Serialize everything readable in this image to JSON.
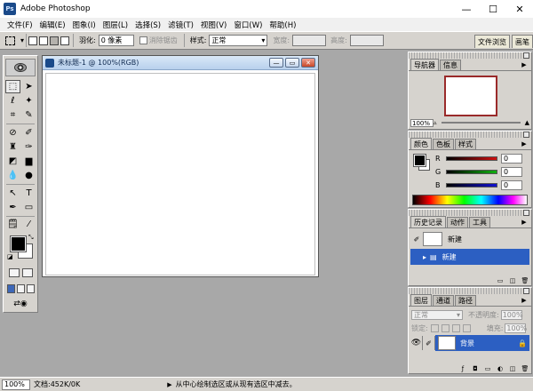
{
  "window": {
    "title": "Adobe Photoshop",
    "minimize": "—",
    "maximize": "☐",
    "close": "✕"
  },
  "menu": [
    "文件(F)",
    "编辑(E)",
    "图象(I)",
    "图层(L)",
    "选择(S)",
    "滤镜(T)",
    "视图(V)",
    "窗口(W)",
    "帮助(H)"
  ],
  "options": {
    "feather_label": "羽化:",
    "feather_value": "0 像素",
    "antialias_label": "消除锯齿",
    "style_label": "样式:",
    "style_value": "正常",
    "width_label": "宽度:",
    "height_label": "高度:",
    "well_tabs": [
      "文件浏览",
      "画笔"
    ]
  },
  "document": {
    "title": "未标题-1 @ 100%(RGB)",
    "minimize": "—",
    "maximize": "▭",
    "close": "✕"
  },
  "status": {
    "zoom": "100%",
    "doc_info": "文档:452K/0K",
    "arrow": "▶",
    "hint": "从中心绘制选区或从现有选区中减去。"
  },
  "navigator": {
    "tabs": [
      "导航器",
      "信息"
    ],
    "zoom": "100%"
  },
  "color": {
    "tabs": [
      "颜色",
      "色板",
      "样式"
    ],
    "channels": [
      {
        "label": "R",
        "value": "0",
        "bar": "#d01010"
      },
      {
        "label": "G",
        "value": "0",
        "bar": "#10b010"
      },
      {
        "label": "B",
        "value": "0",
        "bar": "#1010d0"
      }
    ]
  },
  "history": {
    "tabs": [
      "历史记录",
      "动作",
      "工具"
    ],
    "snapshot": "新建",
    "step": "新建"
  },
  "layers": {
    "tabs": [
      "图层",
      "通道",
      "路径"
    ],
    "blend_mode": "正常",
    "opacity_label": "不透明度:",
    "opacity_value": "100%",
    "lock_label": "锁定:",
    "fill_label": "填充:",
    "fill_value": "100%",
    "layer_name": "背景"
  },
  "colors": {
    "accent": "#2c5fc2",
    "workspace": "#a8a8a8",
    "chrome": "#d6d3ce"
  }
}
